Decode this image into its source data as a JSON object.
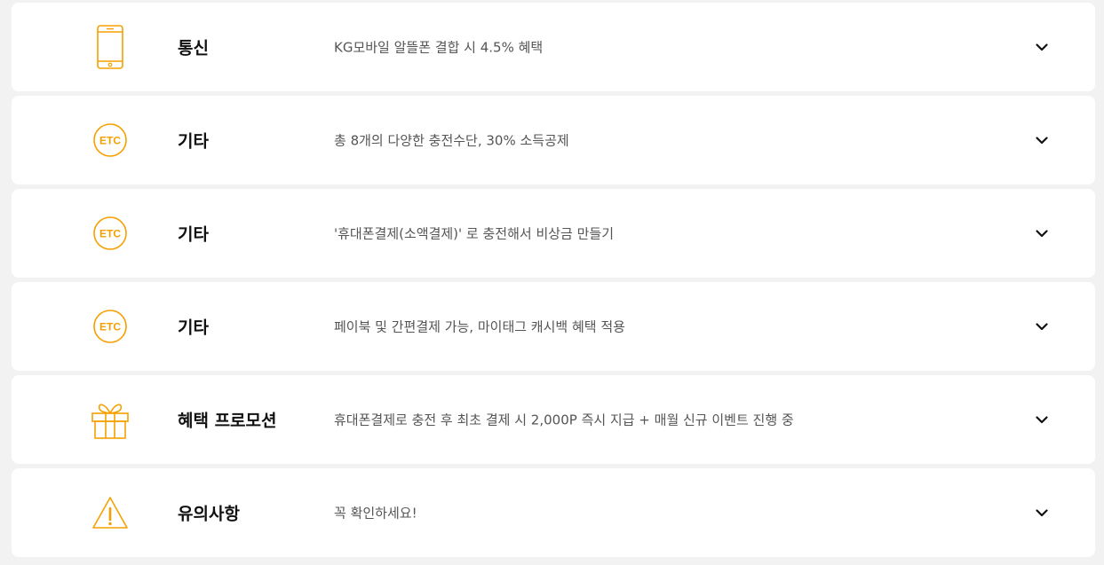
{
  "theme": {
    "accent": "#f5a000",
    "card_bg": "#ffffff",
    "page_bg": "#f2f2f2",
    "title_color": "#111111",
    "desc_color": "#555555"
  },
  "items": [
    {
      "icon": "mobile-phone-icon",
      "title": "통신",
      "desc": "KG모바일 알뜰폰 결합 시 4.5% 혜택"
    },
    {
      "icon": "etc-badge-icon",
      "icon_text": "ETC",
      "title": "기타",
      "desc": "총 8개의 다양한 충전수단, 30% 소득공제"
    },
    {
      "icon": "etc-badge-icon",
      "icon_text": "ETC",
      "title": "기타",
      "desc": "'휴대폰결제(소액결제)' 로 충전해서 비상금 만들기"
    },
    {
      "icon": "etc-badge-icon",
      "icon_text": "ETC",
      "title": "기타",
      "desc": "페이북 및 간편결제 가능, 마이태그 캐시백 혜택 적용"
    },
    {
      "icon": "gift-icon",
      "title": "혜택 프로모션",
      "desc": "휴대폰결제로 충전 후 최초 결제 시 2,000P 즉시 지급 + 매월 신규 이벤트 진행 중"
    },
    {
      "icon": "warning-icon",
      "title": "유의사항",
      "desc": "꼭 확인하세요!"
    }
  ]
}
